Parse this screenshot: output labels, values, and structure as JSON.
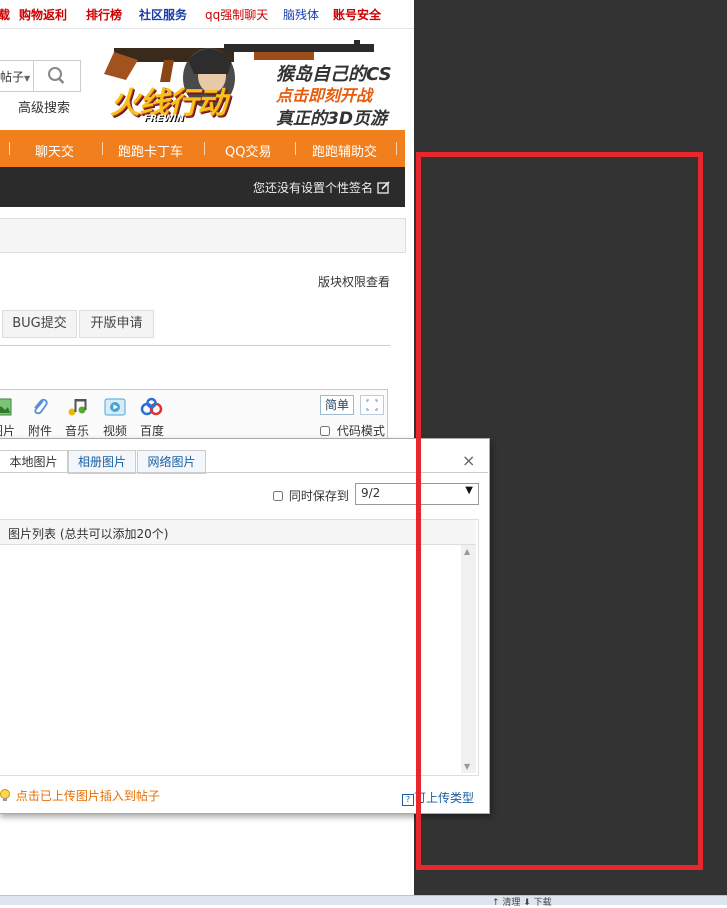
{
  "topnav": {
    "items": [
      {
        "label": "载",
        "color": "#cc0000"
      },
      {
        "label": "购物返利",
        "color": "#cc0000"
      },
      {
        "label": "排行榜",
        "color": "#cc0000"
      },
      {
        "label": "社区服务",
        "color": "#1a3ea8"
      },
      {
        "label": "qq强制聊天",
        "color": "#cc0000"
      },
      {
        "label": "脑残体",
        "color": "#1a3ea8"
      },
      {
        "label": "账号安全",
        "color": "#cc0000"
      }
    ]
  },
  "search": {
    "type_label": "帖子",
    "advanced_label": "高级搜索"
  },
  "banner": {
    "game_title": "火线行动",
    "game_sub": "FREWIN",
    "line1": "猴岛自己的CS",
    "line2": "点击即刻开战",
    "line3": "真正的3D页游"
  },
  "orange_nav": {
    "items": [
      "聊天交",
      "跑跑卡丁车",
      "QQ交易",
      "跑跑辅助交"
    ]
  },
  "darkbar": {
    "signature": "您还没有设置个性签名"
  },
  "forum": {
    "permission_link": "版块权限查看",
    "tabs": [
      "BUG提交",
      "开版申请"
    ]
  },
  "editor": {
    "tools": [
      "图片",
      "附件",
      "音乐",
      "视频",
      "百度"
    ],
    "simple_label": "简单",
    "code_mode_label": "代码模式"
  },
  "dialog": {
    "tabs": [
      "本地图片",
      "相册图片",
      "网络图片"
    ],
    "close_glyph": "×",
    "save_label": "同时保存到",
    "album_value": "9/2",
    "list_title": "图片列表 (总共可以添加20个)",
    "hint": "点击已上传图片插入到帖子",
    "types_label": "可上传类型"
  },
  "status": {
    "text": "↑ 清理   ⬇ 下载"
  },
  "colors": {
    "orange": "#f27f1d",
    "dark_panel": "#333333",
    "red_frame": "#e8262c"
  }
}
